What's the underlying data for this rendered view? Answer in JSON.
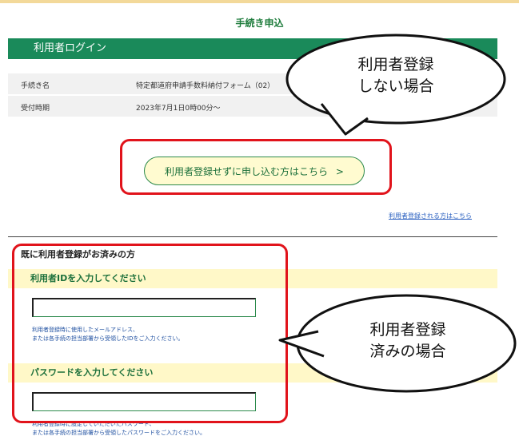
{
  "page": {
    "title": "手続き申込"
  },
  "login": {
    "header": "利用者ログイン"
  },
  "procedure": {
    "rows": [
      {
        "label": "手続き名",
        "value": "特定都道府申請手数料納付フォーム（02）"
      },
      {
        "label": "受付時期",
        "value": "2023年7月1日0時00分～"
      }
    ]
  },
  "actions": {
    "apply_without_register": "利用者登録せずに申し込む方はこちら",
    "register_link": "利用者登録される方はこちら"
  },
  "registered": {
    "section_title": "既に利用者登録がお済みの方",
    "id_label": "利用者IDを入力してください",
    "id_help_1": "利用者登録時に使用したメールアドレス、",
    "id_help_2": "または各手続の担当部署から受領したIDをご入力ください。",
    "password_label": "パスワードを入力してください",
    "password_help_1": "利用者登録時に設定していただいたパスワード、",
    "password_help_2": "または各手続の担当部署から受領したパスワードをご入力ください。"
  },
  "callouts": {
    "not_registered_line1": "利用者登録",
    "not_registered_line2": "しない場合",
    "registered_line1": "利用者登録",
    "registered_line2": "済みの場合"
  },
  "icons": {
    "apply_arrow": "chevron-right-icon"
  },
  "colors": {
    "brand_green": "#1a8a5a",
    "highlight_red": "#e1131b",
    "band_yellow": "#fff8c8"
  }
}
